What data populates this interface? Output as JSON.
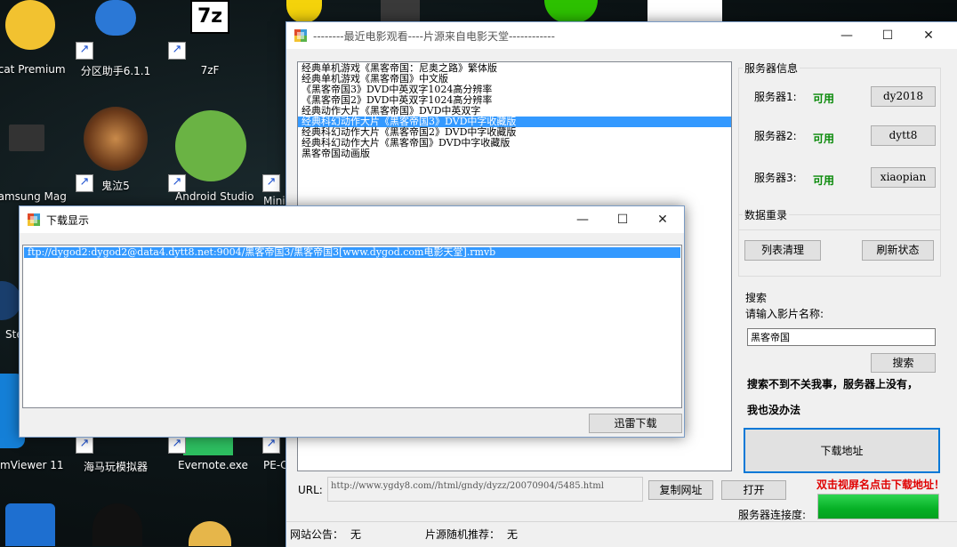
{
  "desktop": {
    "icons": [
      {
        "label": "icat Premium"
      },
      {
        "label": "分区助手6.1.1"
      },
      {
        "label": "7zF"
      },
      {
        "label": "Samsung Mag"
      },
      {
        "label": "鬼泣5"
      },
      {
        "label": "Android Studio"
      },
      {
        "label": "Mini"
      },
      {
        "label": "Ste"
      },
      {
        "label": "mViewer 11"
      },
      {
        "label": "海马玩模拟器"
      },
      {
        "label": "Evernote.exe"
      },
      {
        "label": "PE-C"
      }
    ]
  },
  "main_window": {
    "title": "--------最近电影观看----片源来自电影天堂------------",
    "list_items": [
      "经典单机游戏《黑客帝国：尼奥之路》繁体版",
      "经典单机游戏《黑客帝国》中文版",
      "《黑客帝国3》DVD中英双字1024高分辨率",
      "《黑客帝国2》DVD中英双字1024高分辨率",
      "经典动作大片《黑客帝国》DVD中英双字",
      "经典科幻动作大片《黑客帝国3》DVD中字收藏版",
      "经典科幻动作大片《黑客帝国2》DVD中字收藏版",
      "经典科幻动作大片《黑客帝国》DVD中字收藏版",
      "黑客帝国动画版"
    ],
    "selected_index": 5,
    "server_group": {
      "title": "服务器信息",
      "servers": [
        {
          "label": "服务器1:",
          "status": "可用",
          "button": "dy2018"
        },
        {
          "label": "服务器2:",
          "status": "可用",
          "button": "dytt8"
        },
        {
          "label": "服务器3:",
          "status": "可用",
          "button": "xiaopian"
        }
      ]
    },
    "data_group": {
      "title": "数据重录",
      "clear_button": "列表清理",
      "refresh_button": "刷新状态"
    },
    "search": {
      "title": "搜索",
      "prompt": "请输入影片名称:",
      "value": "黑客帝国",
      "button": "搜索",
      "note_line1": "搜索不到不关我事，服务器上没有，",
      "note_line2": "我也没办法"
    },
    "download_address_button": "下载地址",
    "hint": "双击视屏名点击下载地址！",
    "url_label": "URL:",
    "url_value": "http://www.ygdy8.com//html/gndy/dyzz/20070904/5485.html",
    "copy_button": "复制网址",
    "open_button": "打开",
    "connection_label": "服务器连接度:",
    "connection_level": 1.0,
    "announcement_label": "网站公告：",
    "announcement_value": "无",
    "recommend_label": "片源随机推荐：",
    "recommend_value": "无",
    "colors": {
      "selection": "#3399ff",
      "available": "#0a8a0a",
      "hint": "#e00000",
      "progress": "#06b025"
    }
  },
  "download_window": {
    "title": "下载显示",
    "link": "ftp://dygod2:dygod2@data4.dytt8.net:9004/黑客帝国3/黑客帝国3[www.dygod.com电影天堂].rmvb",
    "button": "迅雷下载"
  }
}
